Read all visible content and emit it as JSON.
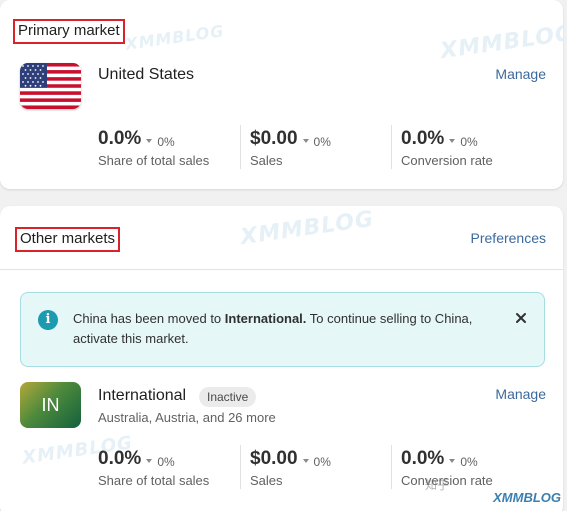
{
  "primary": {
    "title": "Primary market",
    "market_name": "United States",
    "manage_label": "Manage",
    "metrics": [
      {
        "value": "0.0%",
        "delta": "0%",
        "label": "Share of total sales"
      },
      {
        "value": "$0.00",
        "delta": "0%",
        "label": "Sales"
      },
      {
        "value": "0.0%",
        "delta": "0%",
        "label": "Conversion rate"
      }
    ]
  },
  "other": {
    "title": "Other markets",
    "preferences_label": "Preferences",
    "banner": {
      "text_1": "China has been moved to ",
      "text_bold": "International.",
      "text_2": " To continue selling to China, activate this market.",
      "icon": "info-icon"
    },
    "market": {
      "tile_text": "IN",
      "name": "International",
      "status_badge": "Inactive",
      "countries": "Australia, Austria, and 26 more",
      "manage_label": "Manage",
      "metrics": [
        {
          "value": "0.0%",
          "delta": "0%",
          "label": "Share of total sales"
        },
        {
          "value": "$0.00",
          "delta": "0%",
          "label": "Sales"
        },
        {
          "value": "0.0%",
          "delta": "0%",
          "label": "Conversion rate"
        }
      ]
    }
  },
  "watermarks": {
    "brand": "XMMBLOG",
    "zhihu": "知乎"
  },
  "colors": {
    "link": "#3c6a9e",
    "highlight_box": "#d8232a",
    "banner_bg": "#e6f7f8",
    "banner_border": "#a5dde2",
    "info_icon": "#1c9bb0"
  }
}
